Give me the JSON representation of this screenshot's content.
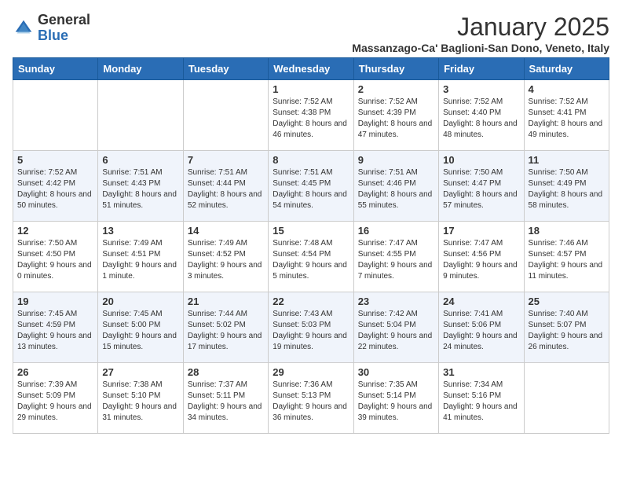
{
  "logo": {
    "general": "General",
    "blue": "Blue"
  },
  "title": "January 2025",
  "subtitle": "Massanzago-Ca' Baglioni-San Dono, Veneto, Italy",
  "weekdays": [
    "Sunday",
    "Monday",
    "Tuesday",
    "Wednesday",
    "Thursday",
    "Friday",
    "Saturday"
  ],
  "weeks": [
    [
      {
        "day": "",
        "sunrise": "",
        "sunset": "",
        "daylight": ""
      },
      {
        "day": "",
        "sunrise": "",
        "sunset": "",
        "daylight": ""
      },
      {
        "day": "",
        "sunrise": "",
        "sunset": "",
        "daylight": ""
      },
      {
        "day": "1",
        "sunrise": "Sunrise: 7:52 AM",
        "sunset": "Sunset: 4:38 PM",
        "daylight": "Daylight: 8 hours and 46 minutes."
      },
      {
        "day": "2",
        "sunrise": "Sunrise: 7:52 AM",
        "sunset": "Sunset: 4:39 PM",
        "daylight": "Daylight: 8 hours and 47 minutes."
      },
      {
        "day": "3",
        "sunrise": "Sunrise: 7:52 AM",
        "sunset": "Sunset: 4:40 PM",
        "daylight": "Daylight: 8 hours and 48 minutes."
      },
      {
        "day": "4",
        "sunrise": "Sunrise: 7:52 AM",
        "sunset": "Sunset: 4:41 PM",
        "daylight": "Daylight: 8 hours and 49 minutes."
      }
    ],
    [
      {
        "day": "5",
        "sunrise": "Sunrise: 7:52 AM",
        "sunset": "Sunset: 4:42 PM",
        "daylight": "Daylight: 8 hours and 50 minutes."
      },
      {
        "day": "6",
        "sunrise": "Sunrise: 7:51 AM",
        "sunset": "Sunset: 4:43 PM",
        "daylight": "Daylight: 8 hours and 51 minutes."
      },
      {
        "day": "7",
        "sunrise": "Sunrise: 7:51 AM",
        "sunset": "Sunset: 4:44 PM",
        "daylight": "Daylight: 8 hours and 52 minutes."
      },
      {
        "day": "8",
        "sunrise": "Sunrise: 7:51 AM",
        "sunset": "Sunset: 4:45 PM",
        "daylight": "Daylight: 8 hours and 54 minutes."
      },
      {
        "day": "9",
        "sunrise": "Sunrise: 7:51 AM",
        "sunset": "Sunset: 4:46 PM",
        "daylight": "Daylight: 8 hours and 55 minutes."
      },
      {
        "day": "10",
        "sunrise": "Sunrise: 7:50 AM",
        "sunset": "Sunset: 4:47 PM",
        "daylight": "Daylight: 8 hours and 57 minutes."
      },
      {
        "day": "11",
        "sunrise": "Sunrise: 7:50 AM",
        "sunset": "Sunset: 4:49 PM",
        "daylight": "Daylight: 8 hours and 58 minutes."
      }
    ],
    [
      {
        "day": "12",
        "sunrise": "Sunrise: 7:50 AM",
        "sunset": "Sunset: 4:50 PM",
        "daylight": "Daylight: 9 hours and 0 minutes."
      },
      {
        "day": "13",
        "sunrise": "Sunrise: 7:49 AM",
        "sunset": "Sunset: 4:51 PM",
        "daylight": "Daylight: 9 hours and 1 minute."
      },
      {
        "day": "14",
        "sunrise": "Sunrise: 7:49 AM",
        "sunset": "Sunset: 4:52 PM",
        "daylight": "Daylight: 9 hours and 3 minutes."
      },
      {
        "day": "15",
        "sunrise": "Sunrise: 7:48 AM",
        "sunset": "Sunset: 4:54 PM",
        "daylight": "Daylight: 9 hours and 5 minutes."
      },
      {
        "day": "16",
        "sunrise": "Sunrise: 7:47 AM",
        "sunset": "Sunset: 4:55 PM",
        "daylight": "Daylight: 9 hours and 7 minutes."
      },
      {
        "day": "17",
        "sunrise": "Sunrise: 7:47 AM",
        "sunset": "Sunset: 4:56 PM",
        "daylight": "Daylight: 9 hours and 9 minutes."
      },
      {
        "day": "18",
        "sunrise": "Sunrise: 7:46 AM",
        "sunset": "Sunset: 4:57 PM",
        "daylight": "Daylight: 9 hours and 11 minutes."
      }
    ],
    [
      {
        "day": "19",
        "sunrise": "Sunrise: 7:45 AM",
        "sunset": "Sunset: 4:59 PM",
        "daylight": "Daylight: 9 hours and 13 minutes."
      },
      {
        "day": "20",
        "sunrise": "Sunrise: 7:45 AM",
        "sunset": "Sunset: 5:00 PM",
        "daylight": "Daylight: 9 hours and 15 minutes."
      },
      {
        "day": "21",
        "sunrise": "Sunrise: 7:44 AM",
        "sunset": "Sunset: 5:02 PM",
        "daylight": "Daylight: 9 hours and 17 minutes."
      },
      {
        "day": "22",
        "sunrise": "Sunrise: 7:43 AM",
        "sunset": "Sunset: 5:03 PM",
        "daylight": "Daylight: 9 hours and 19 minutes."
      },
      {
        "day": "23",
        "sunrise": "Sunrise: 7:42 AM",
        "sunset": "Sunset: 5:04 PM",
        "daylight": "Daylight: 9 hours and 22 minutes."
      },
      {
        "day": "24",
        "sunrise": "Sunrise: 7:41 AM",
        "sunset": "Sunset: 5:06 PM",
        "daylight": "Daylight: 9 hours and 24 minutes."
      },
      {
        "day": "25",
        "sunrise": "Sunrise: 7:40 AM",
        "sunset": "Sunset: 5:07 PM",
        "daylight": "Daylight: 9 hours and 26 minutes."
      }
    ],
    [
      {
        "day": "26",
        "sunrise": "Sunrise: 7:39 AM",
        "sunset": "Sunset: 5:09 PM",
        "daylight": "Daylight: 9 hours and 29 minutes."
      },
      {
        "day": "27",
        "sunrise": "Sunrise: 7:38 AM",
        "sunset": "Sunset: 5:10 PM",
        "daylight": "Daylight: 9 hours and 31 minutes."
      },
      {
        "day": "28",
        "sunrise": "Sunrise: 7:37 AM",
        "sunset": "Sunset: 5:11 PM",
        "daylight": "Daylight: 9 hours and 34 minutes."
      },
      {
        "day": "29",
        "sunrise": "Sunrise: 7:36 AM",
        "sunset": "Sunset: 5:13 PM",
        "daylight": "Daylight: 9 hours and 36 minutes."
      },
      {
        "day": "30",
        "sunrise": "Sunrise: 7:35 AM",
        "sunset": "Sunset: 5:14 PM",
        "daylight": "Daylight: 9 hours and 39 minutes."
      },
      {
        "day": "31",
        "sunrise": "Sunrise: 7:34 AM",
        "sunset": "Sunset: 5:16 PM",
        "daylight": "Daylight: 9 hours and 41 minutes."
      },
      {
        "day": "",
        "sunrise": "",
        "sunset": "",
        "daylight": ""
      }
    ]
  ]
}
